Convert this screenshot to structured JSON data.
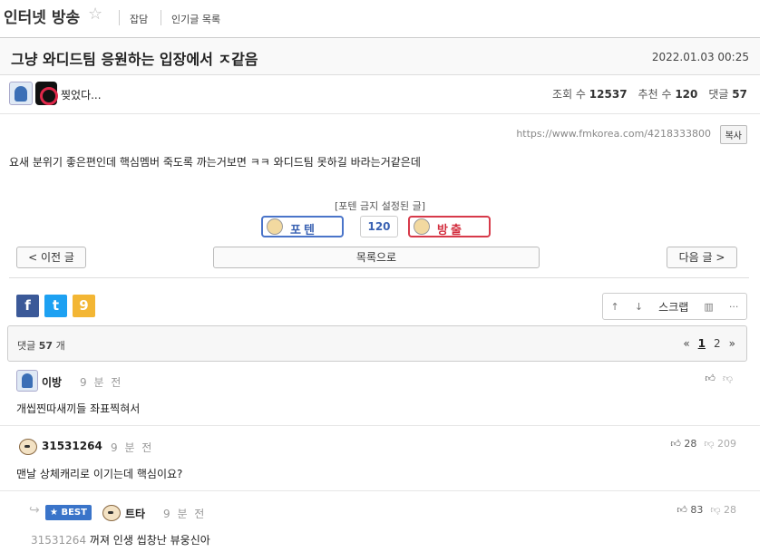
{
  "header": {
    "board_title": "인터넷 방송",
    "star_icon": "☆",
    "links": [
      "잡담",
      "인기글 목록"
    ]
  },
  "post": {
    "title": "그냥 와디드팀 응원하는 입장에서 ㅈ같음",
    "date": "2022.01.03 00:25",
    "author": "찢었다...",
    "views_label": "조회 수",
    "views": "12537",
    "recommends_label": "추천 수",
    "recommends": "120",
    "comments_label": "댓글",
    "comments": "57",
    "url": "https://www.fmkorea.com/4218333800",
    "copy_label": "복사",
    "body": "요새 분위기 좋은편인데 핵심멤버 죽도록 까는거보면 ㅋㅋ 와디드팀 못하길 바라는거같은데",
    "no_foten_notice": "[포텐 금지 설정된 글]",
    "vote_up_label": "포텐",
    "vote_count": "120",
    "vote_down_label": "방출"
  },
  "nav": {
    "prev": "< 이전 글",
    "list": "목록으로",
    "next": "다음 글 >"
  },
  "share": {
    "facebook": "f",
    "twitter": "t",
    "kakao": "9"
  },
  "tools": {
    "scrap": "스크랩",
    "up_icon": "↑",
    "down_icon": "↓",
    "chart_icon": "▥",
    "more_icon": "···"
  },
  "comments_section": {
    "count_prefix": "댓글",
    "count": "57",
    "count_suffix": "개",
    "pager_prev": "«",
    "pages": [
      "1",
      "2"
    ],
    "pager_next": "»"
  },
  "comments": [
    {
      "name": "이방",
      "time": "9 분 전",
      "text": "개씹찐따새끼들 좌표찍혀서",
      "up": "",
      "down": ""
    },
    {
      "name": "31531264",
      "time": "9 분 전",
      "text": "맨날 상체캐리로 이기는데 핵심이요?",
      "up": "28",
      "down": "209"
    },
    {
      "best": "BEST",
      "name": "트타",
      "time": "9 분 전",
      "reply_to": "31531264",
      "text": "꺼져 인생 씹창난 뷰웅신아",
      "up": "83",
      "down": "28"
    }
  ],
  "colors": {
    "accent_blue": "#3b63b3",
    "accent_red": "#d32f3f",
    "facebook": "#3b5998",
    "twitter": "#1da1f2",
    "kakao": "#f3b634",
    "best_badge": "#3a74c9"
  }
}
